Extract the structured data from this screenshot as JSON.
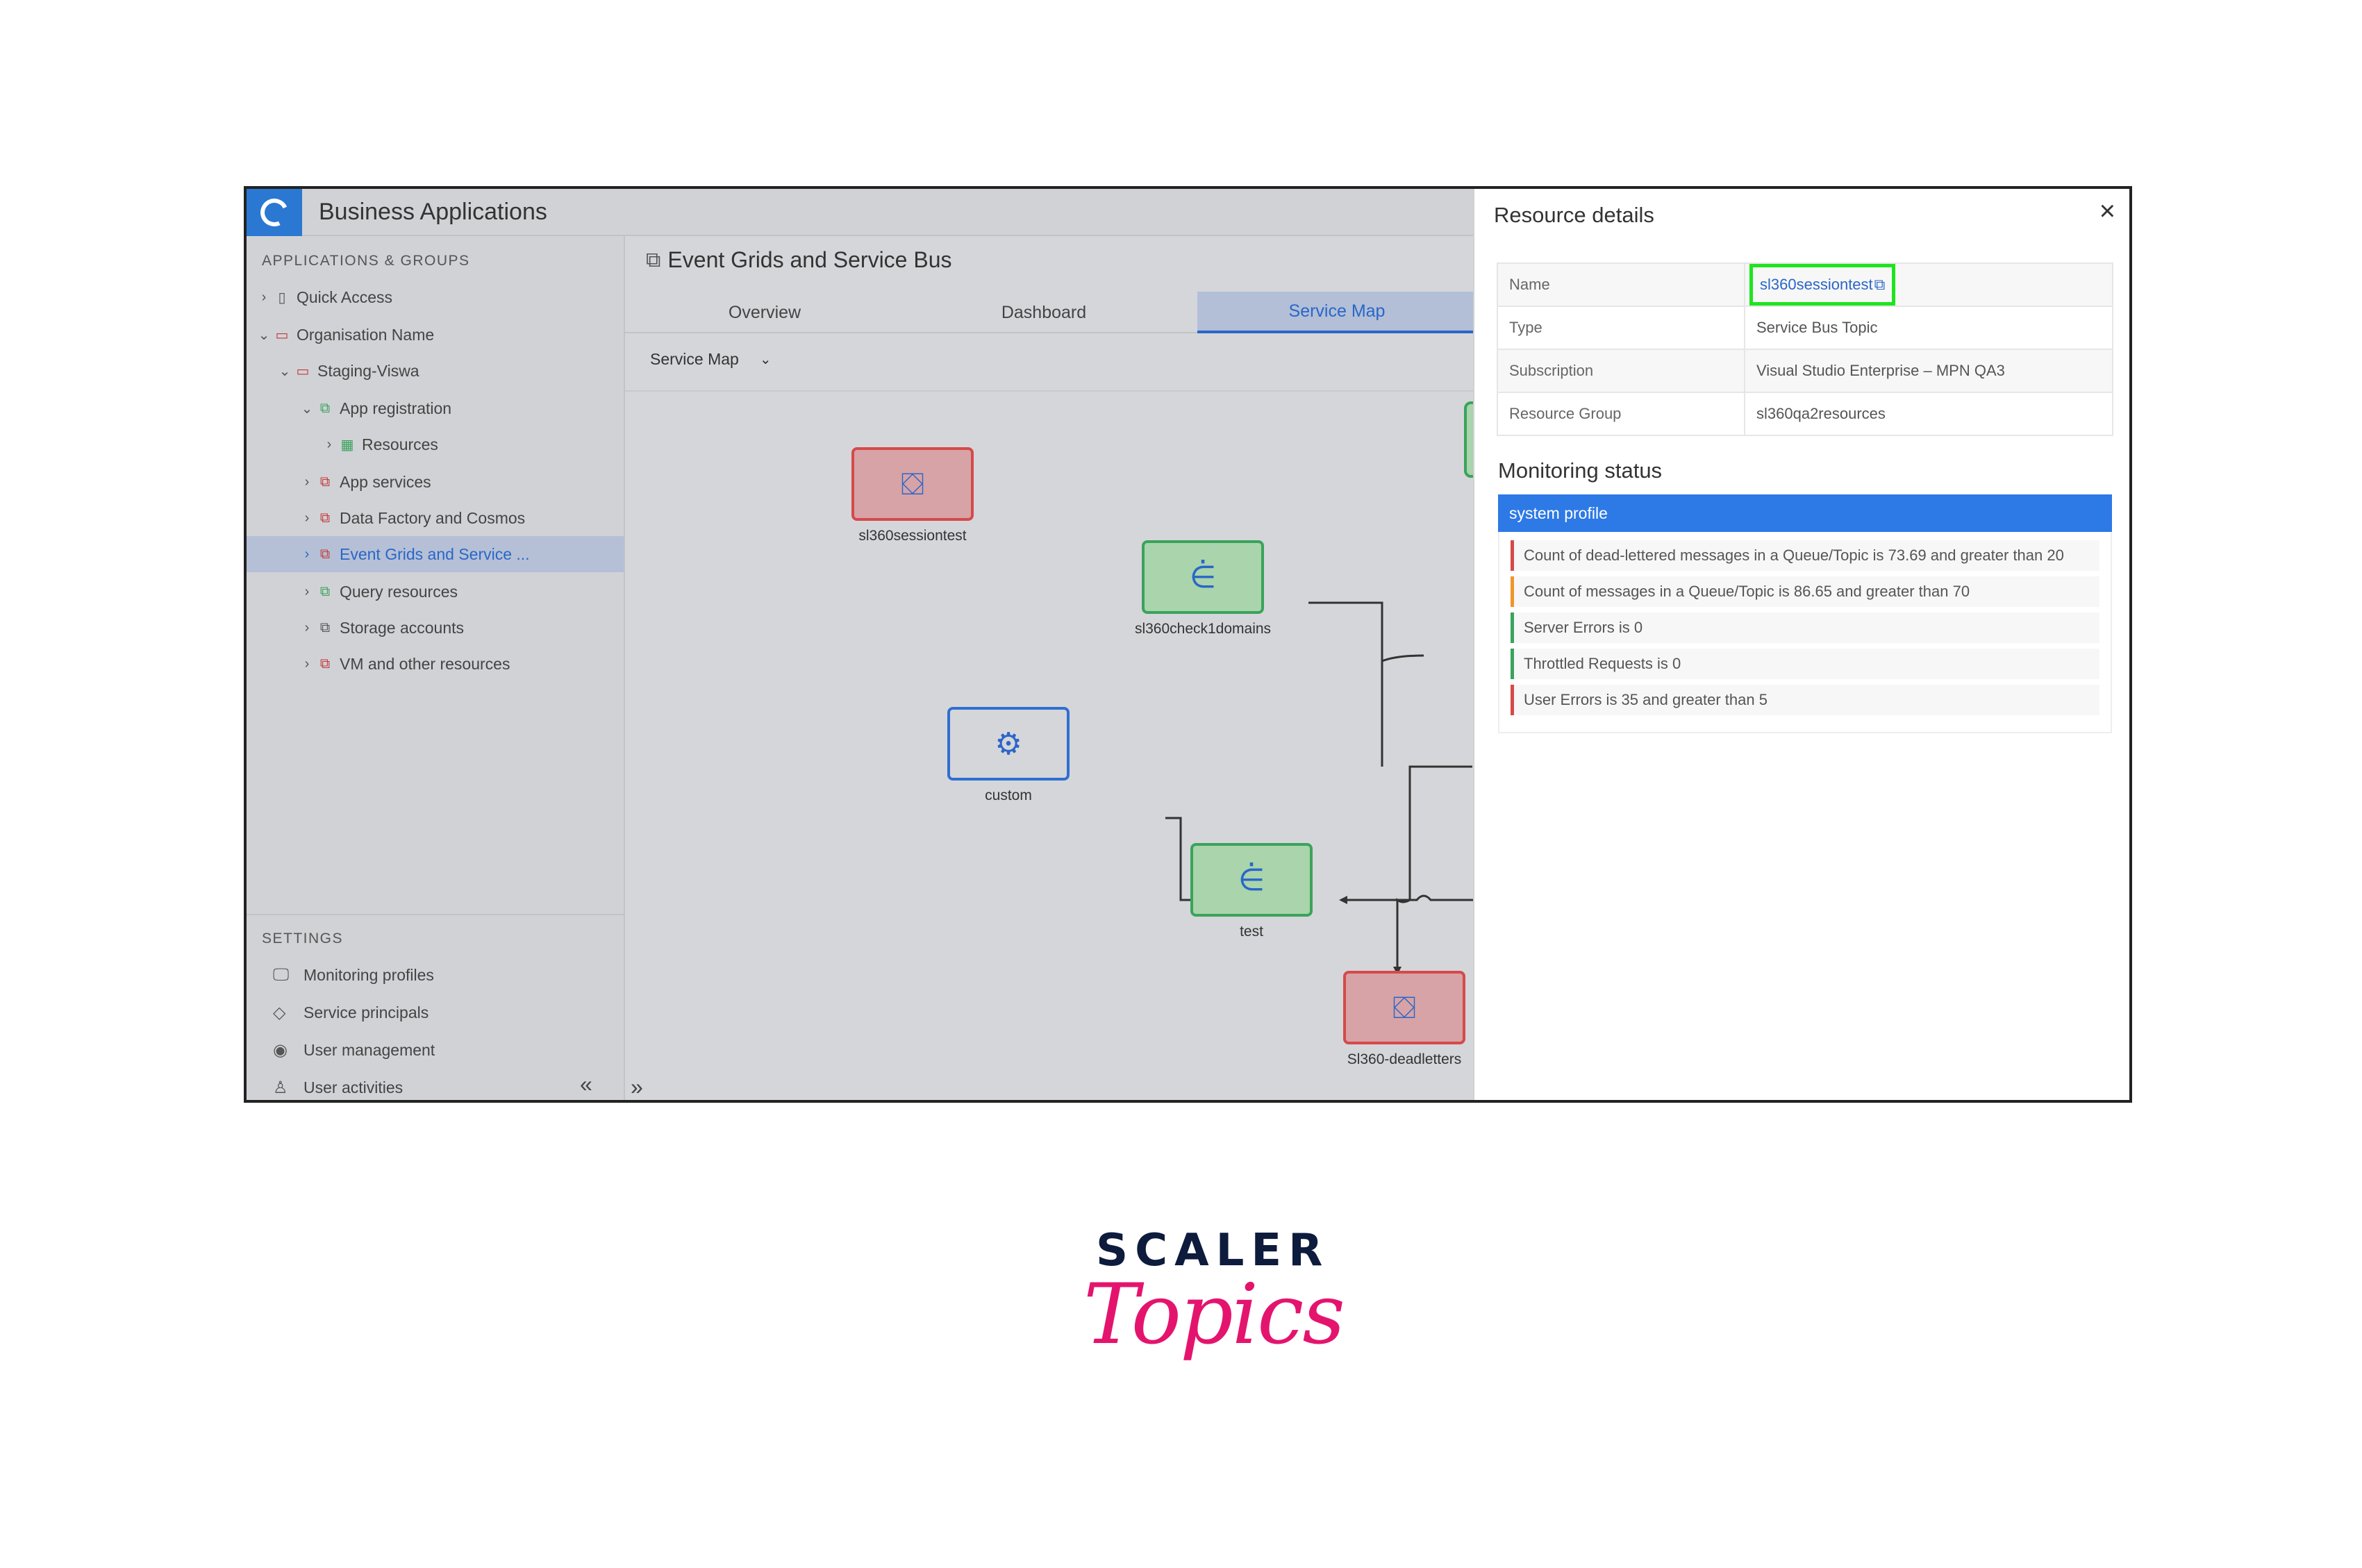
{
  "app": {
    "title": "Business Applications"
  },
  "sidebar": {
    "section_apps": "APPLICATIONS & GROUPS",
    "items": [
      {
        "label": "Quick Access",
        "icon": "bookmark-icon"
      },
      {
        "label": "Organisation Name",
        "icon": "folder-icon"
      },
      {
        "label": "Staging-Viswa",
        "icon": "folder-icon"
      },
      {
        "label": "App registration",
        "icon": "app-group-icon"
      },
      {
        "label": "Resources",
        "icon": "grid-icon"
      },
      {
        "label": "App services",
        "icon": "app-group-icon"
      },
      {
        "label": "Data Factory and Cosmos",
        "icon": "app-group-icon"
      },
      {
        "label": "Event Grids and Service ...",
        "icon": "app-group-icon"
      },
      {
        "label": "Query resources",
        "icon": "app-group-icon"
      },
      {
        "label": "Storage accounts",
        "icon": "app-group-icon"
      },
      {
        "label": "VM and other resources",
        "icon": "app-group-icon"
      }
    ],
    "section_settings": "SETTINGS",
    "settings": [
      {
        "label": "Monitoring profiles",
        "icon": "monitor-icon"
      },
      {
        "label": "Service principals",
        "icon": "diamond-icon"
      },
      {
        "label": "User management",
        "icon": "user-circle-icon"
      },
      {
        "label": "User activities",
        "icon": "user-activity-icon"
      }
    ]
  },
  "main": {
    "title": "Event Grids and Service Bus",
    "tabs": [
      {
        "label": "Overview"
      },
      {
        "label": "Dashboard"
      },
      {
        "label": "Service Map"
      }
    ],
    "active_tab": "Service Map",
    "view_select": "Service Map",
    "nodes": [
      {
        "label": "sl360sessiontest",
        "status": "red",
        "icon": "service-bus-icon"
      },
      {
        "label": "sl360check1domains",
        "status": "green",
        "icon": "event-grid-icon"
      },
      {
        "label": "custom",
        "status": "blue",
        "icon": "gear-icon"
      },
      {
        "label": "test",
        "status": "green",
        "icon": "event-grid-icon"
      },
      {
        "label": "Sl360-deadletters",
        "status": "red",
        "icon": "service-bus-icon"
      }
    ]
  },
  "panel": {
    "title": "Resource details",
    "details": [
      {
        "key": "Name",
        "value": "sl360sessiontest"
      },
      {
        "key": "Type",
        "value": "Service Bus Topic"
      },
      {
        "key": "Subscription",
        "value": "Visual Studio Enterprise – MPN QA3"
      },
      {
        "key": "Resource Group",
        "value": "sl360qa2resources"
      }
    ],
    "monitoring_title": "Monitoring status",
    "profile": "system profile",
    "alerts": [
      {
        "text": "Count of dead-lettered messages in a Queue/Topic is 73.69 and greater than 20",
        "level": "error"
      },
      {
        "text": "Count of messages in a Queue/Topic is 86.65 and greater than 70",
        "level": "warning"
      },
      {
        "text": "Server Errors is 0",
        "level": "ok"
      },
      {
        "text": "Throttled Requests is 0",
        "level": "ok"
      },
      {
        "text": "User Errors is 35 and greater than 5",
        "level": "error"
      }
    ]
  },
  "brand": {
    "line1": "SCALER",
    "line2": "Topics"
  },
  "colors": {
    "accent": "#2a66c8",
    "profile_bar": "#2d79e6",
    "error": "#d54a4a",
    "warning": "#f0952b",
    "ok": "#3aa35c",
    "highlight": "#1fe41f",
    "brand_pink": "#e4146e",
    "brand_navy": "#0d1b3c"
  }
}
